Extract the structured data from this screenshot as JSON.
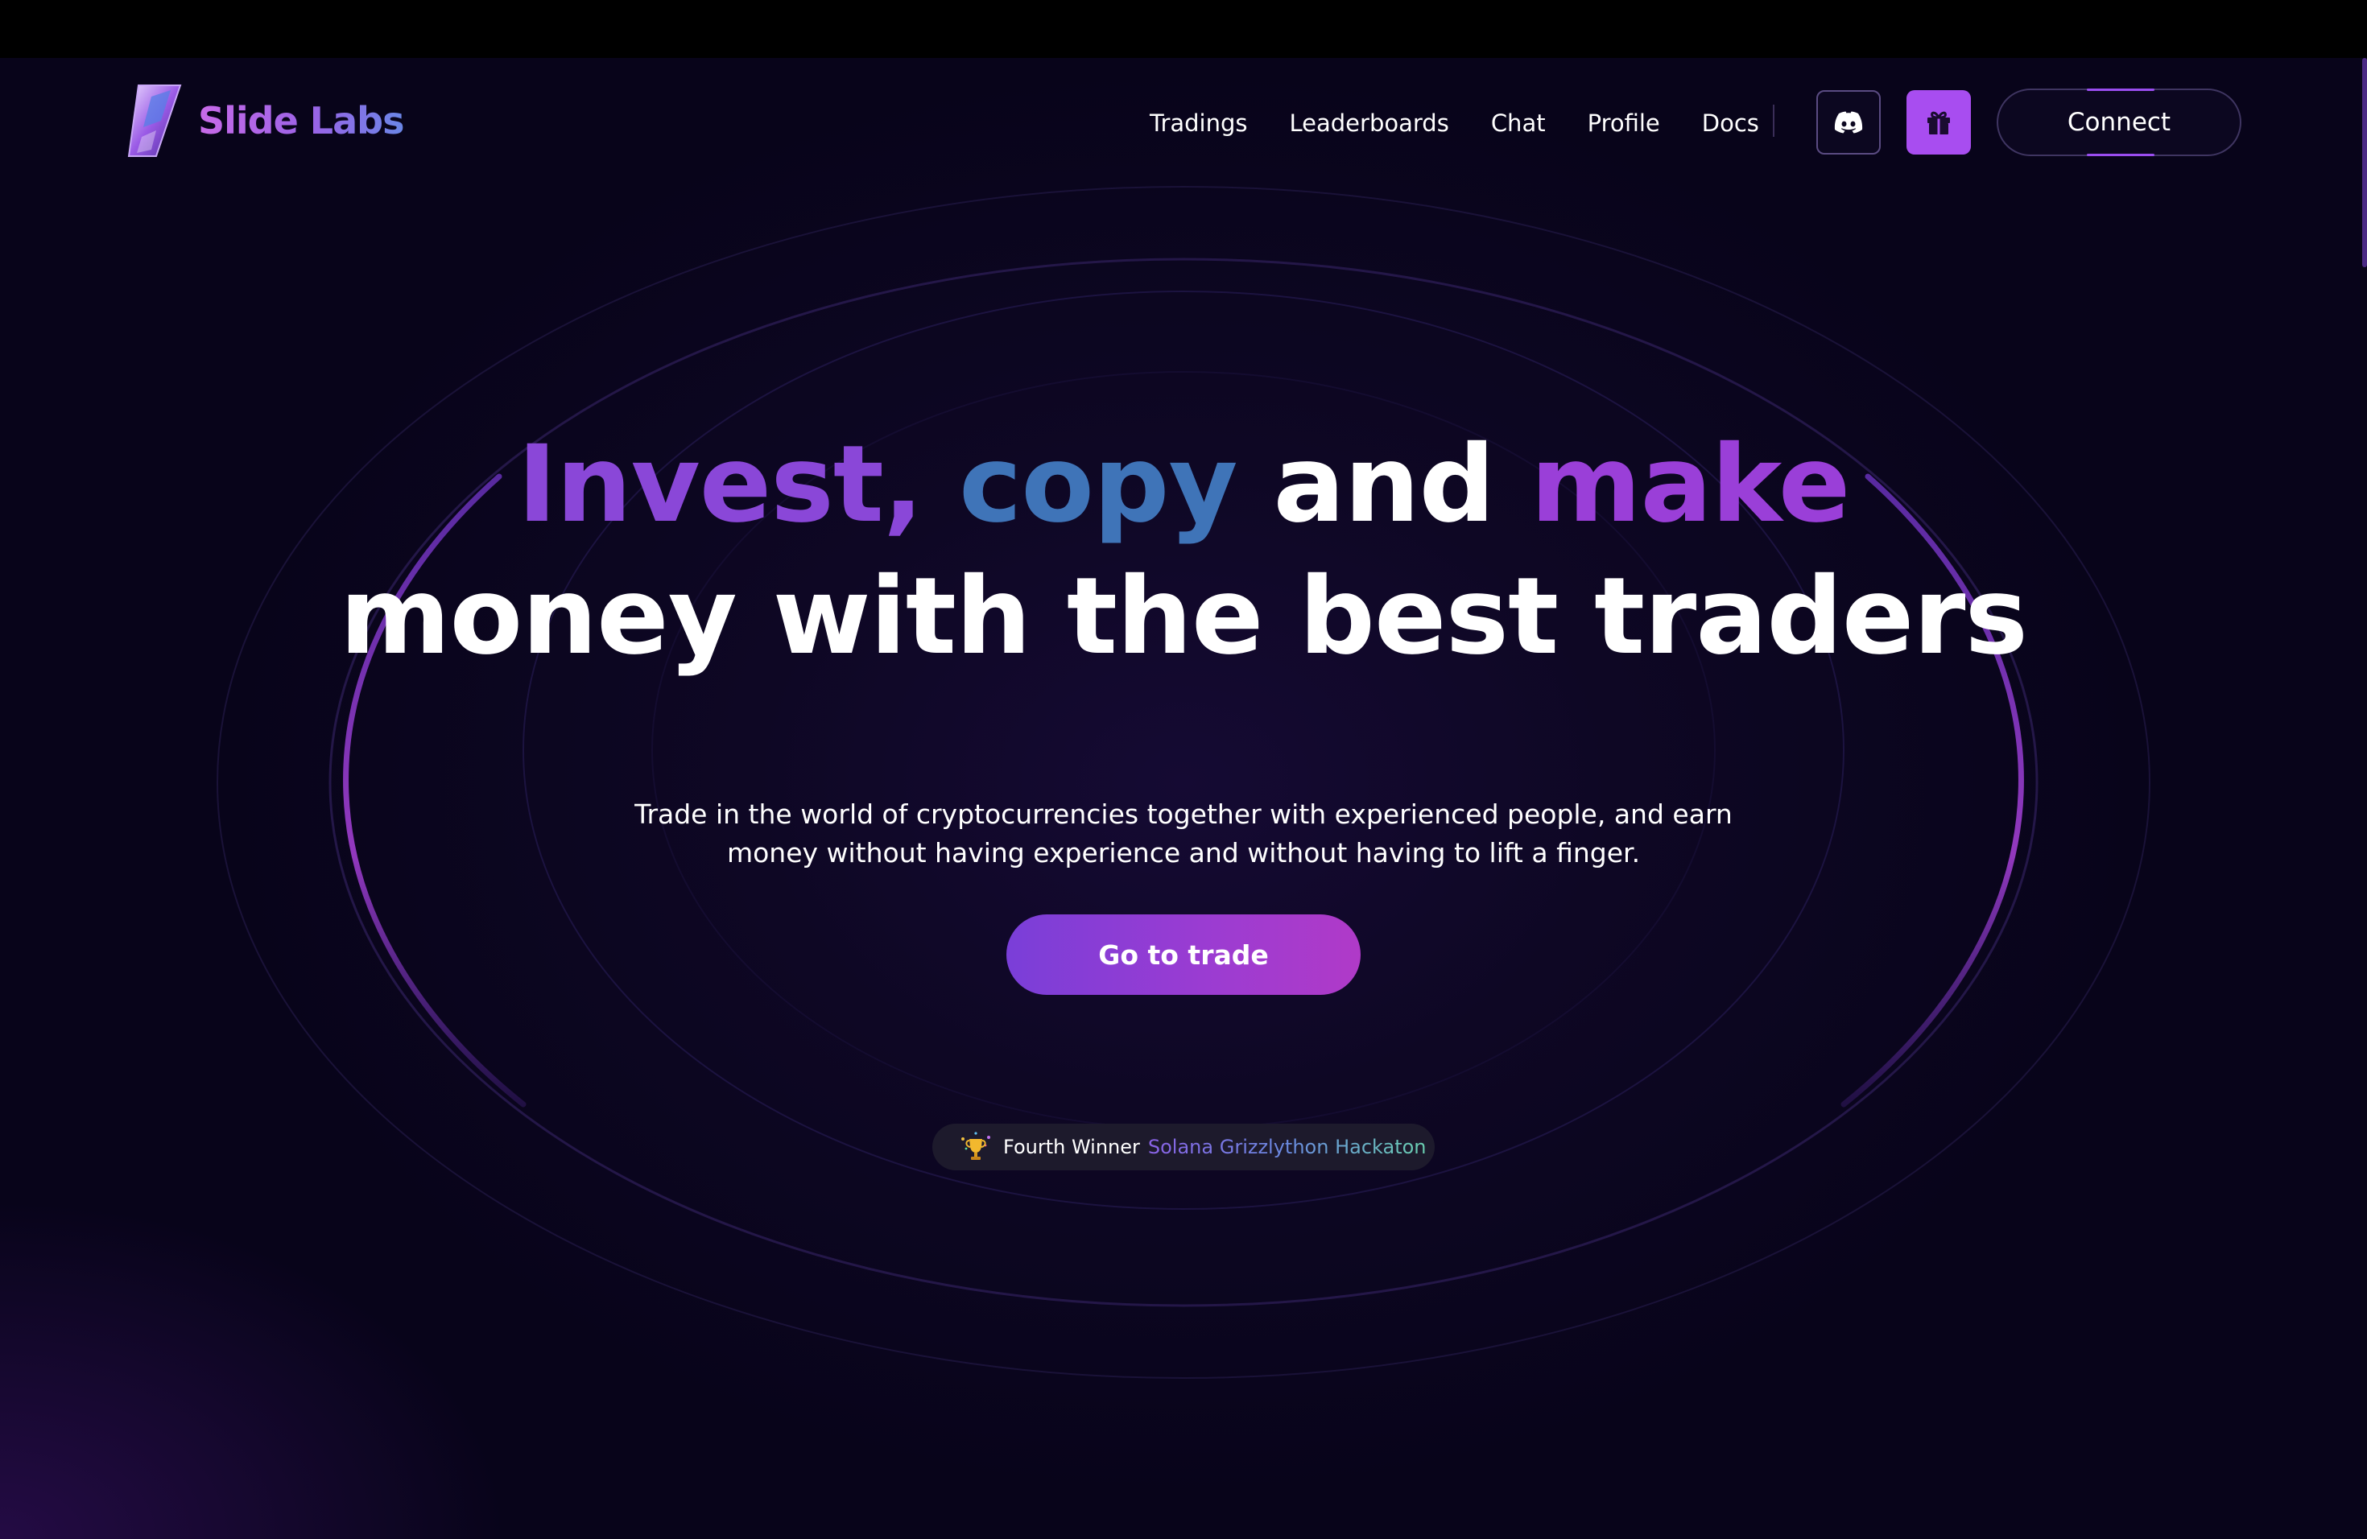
{
  "header": {
    "logo_text": "Slide Labs",
    "nav": [
      "Tradings",
      "Leaderboards",
      "Chat",
      "Profile",
      "Docs"
    ],
    "discord_icon": "discord-icon",
    "gift_icon": "gift-icon",
    "connect_label": "Connect"
  },
  "hero": {
    "title_words": [
      "Invest,",
      "copy",
      "and",
      "make"
    ],
    "title_line2": "money with the best traders",
    "subtitle": "Trade in the world of cryptocurrencies together with experienced people, and earn money without having experience and without having to lift a finger.",
    "cta_label": "Go to trade",
    "badge_prefix": "Fourth Winner",
    "badge_highlight": "Solana Grizzlython Hackaton",
    "badge_icon": "trophy-icon"
  },
  "colors": {
    "accent_purple": "#a84df0",
    "background": "#0e0724",
    "title_invest": "#8a47d8",
    "title_copy": "#3f74b8",
    "title_make": "#9a3fd8"
  }
}
